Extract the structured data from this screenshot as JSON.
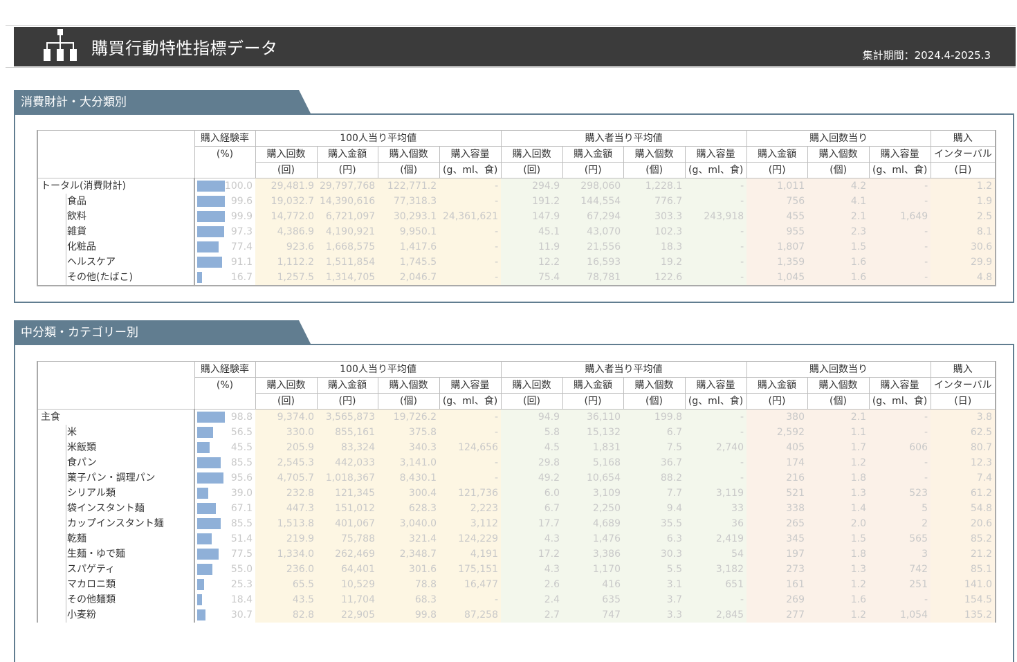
{
  "header": {
    "title": "購買行動特性指標データ",
    "period": "集計期間：2024.4-2025.3"
  },
  "section1": {
    "label": "消費財計・大分類別"
  },
  "section2": {
    "label": "中分類・カテゴリー別"
  },
  "columns": {
    "rate": "購入経験率",
    "rate_unit": "(%)",
    "group_per100": "100人当り平均値",
    "group_perbuyer": "購入者当り平均値",
    "group_pertrip": "購入回数当り",
    "interval1": "購入",
    "interval2": "インターバル",
    "interval_unit": "(日)",
    "count": "購入回数",
    "count_unit": "(回)",
    "amount": "購入金額",
    "amount_unit": "(円)",
    "items": "購入個数",
    "items_unit": "(個)",
    "volume": "購入容量",
    "volume_unit": "(g、ml、食)"
  },
  "table1": [
    {
      "name": "トータル(消費財計)",
      "rate": "100.0",
      "bar": 1.0,
      "c1": "29,481.9",
      "c2": "29,797,768",
      "c3": "122,771.2",
      "c4": "-",
      "c5": "294.9",
      "c6": "298,060",
      "c7": "1,228.1",
      "c8": "-",
      "c9": "1,011",
      "c10": "4.2",
      "c11": "-",
      "c12": "1.2"
    },
    {
      "name": "食品",
      "rate": "99.6",
      "bar": 0.996,
      "c1": "19,032.7",
      "c2": "14,390,616",
      "c3": "77,318.3",
      "c4": "-",
      "c5": "191.2",
      "c6": "144,554",
      "c7": "776.7",
      "c8": "-",
      "c9": "756",
      "c10": "4.1",
      "c11": "-",
      "c12": "1.9"
    },
    {
      "name": "飲料",
      "rate": "99.9",
      "bar": 0.999,
      "c1": "14,772.0",
      "c2": "6,721,097",
      "c3": "30,293.1",
      "c4": "24,361,621",
      "c5": "147.9",
      "c6": "67,294",
      "c7": "303.3",
      "c8": "243,918",
      "c9": "455",
      "c10": "2.1",
      "c11": "1,649",
      "c12": "2.5"
    },
    {
      "name": "雑貨",
      "rate": "97.3",
      "bar": 0.973,
      "c1": "4,386.9",
      "c2": "4,190,921",
      "c3": "9,950.1",
      "c4": "-",
      "c5": "45.1",
      "c6": "43,070",
      "c7": "102.3",
      "c8": "-",
      "c9": "955",
      "c10": "2.3",
      "c11": "-",
      "c12": "8.1"
    },
    {
      "name": "化粧品",
      "rate": "77.4",
      "bar": 0.774,
      "c1": "923.6",
      "c2": "1,668,575",
      "c3": "1,417.6",
      "c4": "-",
      "c5": "11.9",
      "c6": "21,556",
      "c7": "18.3",
      "c8": "-",
      "c9": "1,807",
      "c10": "1.5",
      "c11": "-",
      "c12": "30.6"
    },
    {
      "name": "ヘルスケア",
      "rate": "91.1",
      "bar": 0.911,
      "c1": "1,112.2",
      "c2": "1,511,854",
      "c3": "1,745.5",
      "c4": "-",
      "c5": "12.2",
      "c6": "16,593",
      "c7": "19.2",
      "c8": "-",
      "c9": "1,359",
      "c10": "1.6",
      "c11": "-",
      "c12": "29.9"
    },
    {
      "name": "その他(たばこ)",
      "rate": "16.7",
      "bar": 0.167,
      "c1": "1,257.5",
      "c2": "1,314,705",
      "c3": "2,046.7",
      "c4": "-",
      "c5": "75.4",
      "c6": "78,781",
      "c7": "122.6",
      "c8": "-",
      "c9": "1,045",
      "c10": "1.6",
      "c11": "-",
      "c12": "4.8"
    }
  ],
  "table2": [
    {
      "name": "主食",
      "rate": "98.8",
      "bar": 0.988,
      "c1": "9,374.0",
      "c2": "3,565,873",
      "c3": "19,726.2",
      "c4": "-",
      "c5": "94.9",
      "c6": "36,110",
      "c7": "199.8",
      "c8": "-",
      "c9": "380",
      "c10": "2.1",
      "c11": "-",
      "c12": "3.8"
    },
    {
      "name": "米",
      "rate": "56.5",
      "bar": 0.565,
      "c1": "330.0",
      "c2": "855,161",
      "c3": "375.8",
      "c4": "-",
      "c5": "5.8",
      "c6": "15,132",
      "c7": "6.7",
      "c8": "-",
      "c9": "2,592",
      "c10": "1.1",
      "c11": "-",
      "c12": "62.5"
    },
    {
      "name": "米飯類",
      "rate": "45.5",
      "bar": 0.455,
      "c1": "205.9",
      "c2": "83,324",
      "c3": "340.3",
      "c4": "124,656",
      "c5": "4.5",
      "c6": "1,831",
      "c7": "7.5",
      "c8": "2,740",
      "c9": "405",
      "c10": "1.7",
      "c11": "606",
      "c12": "80.7"
    },
    {
      "name": "食パン",
      "rate": "85.5",
      "bar": 0.855,
      "c1": "2,545.3",
      "c2": "442,033",
      "c3": "3,141.0",
      "c4": "-",
      "c5": "29.8",
      "c6": "5,168",
      "c7": "36.7",
      "c8": "-",
      "c9": "174",
      "c10": "1.2",
      "c11": "-",
      "c12": "12.3"
    },
    {
      "name": "菓子パン・調理パン",
      "rate": "95.6",
      "bar": 0.956,
      "c1": "4,705.7",
      "c2": "1,018,367",
      "c3": "8,430.1",
      "c4": "-",
      "c5": "49.2",
      "c6": "10,654",
      "c7": "88.2",
      "c8": "-",
      "c9": "216",
      "c10": "1.8",
      "c11": "-",
      "c12": "7.4"
    },
    {
      "name": "シリアル類",
      "rate": "39.0",
      "bar": 0.39,
      "c1": "232.8",
      "c2": "121,345",
      "c3": "300.4",
      "c4": "121,736",
      "c5": "6.0",
      "c6": "3,109",
      "c7": "7.7",
      "c8": "3,119",
      "c9": "521",
      "c10": "1.3",
      "c11": "523",
      "c12": "61.2"
    },
    {
      "name": "袋インスタント麺",
      "rate": "67.1",
      "bar": 0.671,
      "c1": "447.3",
      "c2": "151,012",
      "c3": "628.3",
      "c4": "2,223",
      "c5": "6.7",
      "c6": "2,250",
      "c7": "9.4",
      "c8": "33",
      "c9": "338",
      "c10": "1.4",
      "c11": "5",
      "c12": "54.8"
    },
    {
      "name": "カップインスタント麺",
      "rate": "85.5",
      "bar": 0.855,
      "c1": "1,513.8",
      "c2": "401,067",
      "c3": "3,040.0",
      "c4": "3,112",
      "c5": "17.7",
      "c6": "4,689",
      "c7": "35.5",
      "c8": "36",
      "c9": "265",
      "c10": "2.0",
      "c11": "2",
      "c12": "20.6"
    },
    {
      "name": "乾麺",
      "rate": "51.4",
      "bar": 0.514,
      "c1": "219.9",
      "c2": "75,788",
      "c3": "321.4",
      "c4": "124,229",
      "c5": "4.3",
      "c6": "1,476",
      "c7": "6.3",
      "c8": "2,419",
      "c9": "345",
      "c10": "1.5",
      "c11": "565",
      "c12": "85.2"
    },
    {
      "name": "生麺・ゆで麺",
      "rate": "77.5",
      "bar": 0.775,
      "c1": "1,334.0",
      "c2": "262,469",
      "c3": "2,348.7",
      "c4": "4,191",
      "c5": "17.2",
      "c6": "3,386",
      "c7": "30.3",
      "c8": "54",
      "c9": "197",
      "c10": "1.8",
      "c11": "3",
      "c12": "21.2"
    },
    {
      "name": "スパゲティ",
      "rate": "55.0",
      "bar": 0.55,
      "c1": "236.0",
      "c2": "64,401",
      "c3": "301.6",
      "c4": "175,151",
      "c5": "4.3",
      "c6": "1,170",
      "c7": "5.5",
      "c8": "3,182",
      "c9": "273",
      "c10": "1.3",
      "c11": "742",
      "c12": "85.1"
    },
    {
      "name": "マカロニ類",
      "rate": "25.3",
      "bar": 0.253,
      "c1": "65.5",
      "c2": "10,529",
      "c3": "78.8",
      "c4": "16,477",
      "c5": "2.6",
      "c6": "416",
      "c7": "3.1",
      "c8": "651",
      "c9": "161",
      "c10": "1.2",
      "c11": "251",
      "c12": "141.0"
    },
    {
      "name": "その他麺類",
      "rate": "18.4",
      "bar": 0.184,
      "c1": "43.5",
      "c2": "11,704",
      "c3": "68.3",
      "c4": "-",
      "c5": "2.4",
      "c6": "635",
      "c7": "3.7",
      "c8": "-",
      "c9": "269",
      "c10": "1.6",
      "c11": "-",
      "c12": "154.5"
    },
    {
      "name": "小麦粉",
      "rate": "30.7",
      "bar": 0.307,
      "c1": "82.8",
      "c2": "22,905",
      "c3": "99.8",
      "c4": "87,258",
      "c5": "2.7",
      "c6": "747",
      "c7": "3.3",
      "c8": "2,845",
      "c9": "277",
      "c10": "1.2",
      "c11": "1,054",
      "c12": "135.2"
    }
  ]
}
